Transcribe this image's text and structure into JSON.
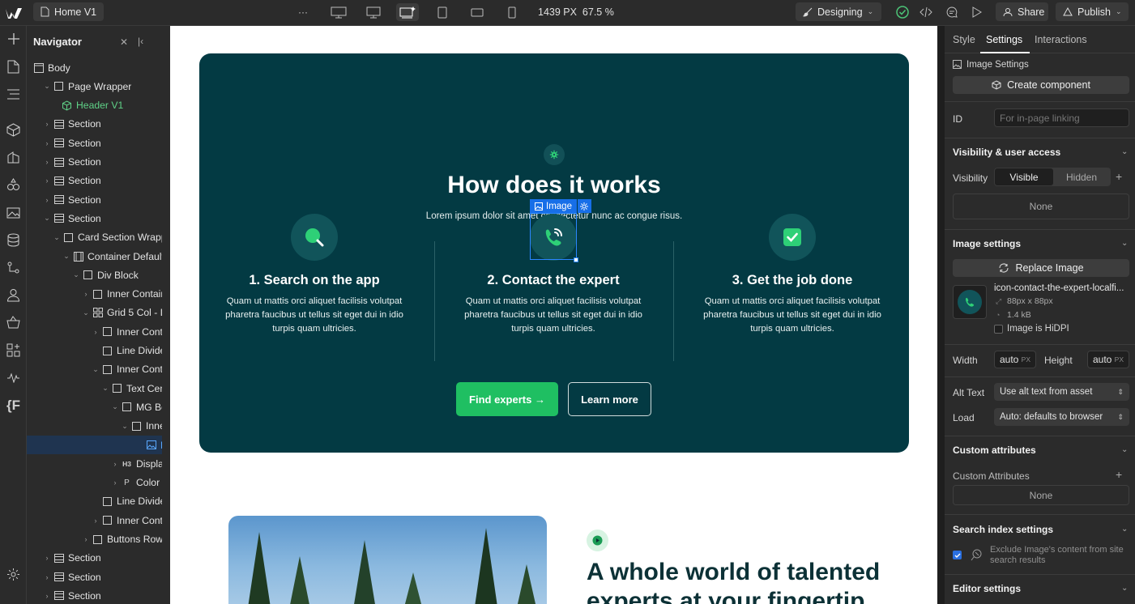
{
  "topbar": {
    "page_name": "Home V1",
    "more": "···",
    "viewport_width": "1439 PX",
    "zoom": "67.5 %",
    "mode": "Designing",
    "share": "Share",
    "publish": "Publish"
  },
  "navigator": {
    "title": "Navigator",
    "rows": [
      {
        "label": "Body",
        "icon": "body-icon",
        "color": "normal"
      },
      {
        "label": "Page Wrapper",
        "icon": "div-icon",
        "color": "normal"
      },
      {
        "label": "Header V1",
        "icon": "component-icon",
        "color": "green"
      },
      {
        "label": "Section",
        "icon": "section-icon",
        "color": "normal"
      },
      {
        "label": "Section",
        "icon": "section-icon",
        "color": "normal"
      },
      {
        "label": "Section",
        "icon": "section-icon",
        "color": "normal"
      },
      {
        "label": "Section",
        "icon": "section-icon",
        "color": "normal"
      },
      {
        "label": "Section",
        "icon": "section-icon",
        "color": "normal"
      },
      {
        "label": "Section",
        "icon": "section-icon",
        "color": "normal"
      },
      {
        "label": "Card Section Wrapp",
        "icon": "div-icon",
        "color": "normal"
      },
      {
        "label": "Container Default",
        "icon": "container-icon",
        "color": "normal"
      },
      {
        "label": "Div Block",
        "icon": "div-icon",
        "color": "normal"
      },
      {
        "label": "Inner Contain",
        "icon": "div-icon",
        "color": "normal"
      },
      {
        "label": "Grid 5 Col - L",
        "icon": "grid-icon",
        "color": "normal"
      },
      {
        "label": "Inner Conta",
        "icon": "div-icon",
        "color": "normal"
      },
      {
        "label": "Line Divide",
        "icon": "div-icon",
        "color": "normal"
      },
      {
        "label": "Inner Conta",
        "icon": "div-icon",
        "color": "normal"
      },
      {
        "label": "Text Cen",
        "icon": "div-icon",
        "color": "normal"
      },
      {
        "label": "MG Bo",
        "icon": "div-icon",
        "color": "normal"
      },
      {
        "label": "Inne",
        "icon": "div-icon",
        "color": "normal"
      },
      {
        "label": "Im",
        "icon": "image-icon",
        "color": "blue"
      },
      {
        "label": "Display",
        "icon": "h3-icon",
        "color": "normal"
      },
      {
        "label": "Color N",
        "icon": "p-icon",
        "color": "normal"
      },
      {
        "label": "Line Divide",
        "icon": "div-icon",
        "color": "normal"
      },
      {
        "label": "Inner Conta",
        "icon": "div-icon",
        "color": "normal"
      },
      {
        "label": "Buttons Row",
        "icon": "div-icon",
        "color": "normal"
      },
      {
        "label": "Section",
        "icon": "section-icon",
        "color": "normal"
      },
      {
        "label": "Section",
        "icon": "section-icon",
        "color": "normal"
      },
      {
        "label": "Section",
        "icon": "section-icon",
        "color": "normal"
      }
    ]
  },
  "canvas": {
    "heading": "How does it works",
    "subheading": "Lorem ipsum dolor sit amet consectetur nunc ac congue risus.",
    "selection_label": "Image",
    "steps": [
      {
        "title": "1. Search on the app",
        "text": "Quam ut mattis orci aliquet facilisis volutpat pharetra faucibus ut tellus sit eget dui in idio turpis quam ultricies."
      },
      {
        "title": "2. Contact the expert",
        "text": "Quam ut mattis orci aliquet facilisis volutpat pharetra faucibus ut tellus sit eget dui in idio turpis quam ultricies."
      },
      {
        "title": "3. Get the job done",
        "text": "Quam ut mattis orci aliquet facilisis volutpat pharetra faucibus ut tellus sit eget dui in idio turpis quam ultricies."
      }
    ],
    "primary_button": "Find experts →",
    "secondary_button": "Learn more",
    "next_heading": "A whole world of talented experts at your fingertip"
  },
  "settings_panel": {
    "tabs": [
      "Style",
      "Settings",
      "Interactions"
    ],
    "active_tab": "Settings",
    "element_type": "Image Settings",
    "create_component": "Create component",
    "id_label": "ID",
    "id_placeholder": "For in-page linking",
    "visibility_section": "Visibility & user access",
    "visibility_label": "Visibility",
    "visible": "Visible",
    "hidden": "Hidden",
    "none": "None",
    "image_settings_section": "Image settings",
    "replace_image": "Replace Image",
    "asset_name": "icon-contact-the-expert-localfi...",
    "asset_dims": "88px x 88px",
    "asset_size": "1.4 kB",
    "hidpi_label": "Image is HiDPI",
    "width_label": "Width",
    "width_value": "auto",
    "height_label": "Height",
    "height_value": "auto",
    "unit": "PX",
    "alt_label": "Alt Text",
    "alt_value": "Use alt text from asset",
    "load_label": "Load",
    "load_value": "Auto: defaults to browser",
    "custom_attr_section": "Custom attributes",
    "custom_attr_label": "Custom Attributes",
    "custom_attr_none": "None",
    "search_section": "Search index settings",
    "search_exclude": "Exclude Image's content from site search results",
    "editor_section": "Editor settings"
  },
  "colors": {
    "card_bg": "#033a43",
    "accent_green": "#1fbf62",
    "selection_blue": "#176fe8"
  }
}
